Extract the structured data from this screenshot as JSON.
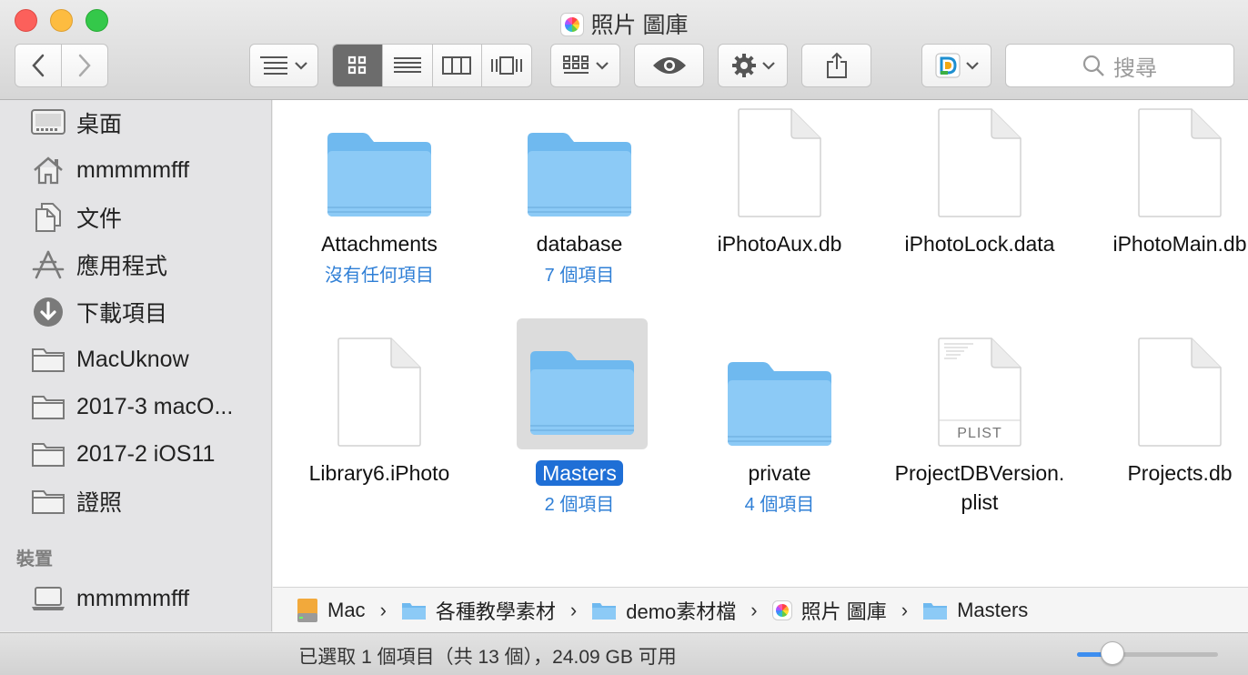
{
  "window": {
    "title": "照片 圖庫"
  },
  "toolbar": {
    "search_placeholder": "搜尋",
    "view_modes": [
      "icon-view",
      "list-view",
      "column-view",
      "coverflow-view"
    ],
    "active_view": "icon-view"
  },
  "sidebar": {
    "favorites": [
      {
        "label": "桌面",
        "icon": "desktop-icon"
      },
      {
        "label": "mmmmmfff",
        "icon": "home-icon"
      },
      {
        "label": "文件",
        "icon": "documents-icon"
      },
      {
        "label": "應用程式",
        "icon": "applications-icon"
      },
      {
        "label": "下載項目",
        "icon": "downloads-icon"
      },
      {
        "label": "MacUknow",
        "icon": "folder-icon"
      },
      {
        "label": "2017-3 macO...",
        "icon": "folder-icon"
      },
      {
        "label": "2017-2 iOS11",
        "icon": "folder-icon"
      },
      {
        "label": "證照",
        "icon": "folder-icon"
      }
    ],
    "devices_title": "裝置",
    "devices": [
      {
        "label": "mmmmmfff",
        "icon": "laptop-icon"
      }
    ]
  },
  "files": [
    {
      "name": "Attachments",
      "sub": "沒有任何項目",
      "kind": "folder"
    },
    {
      "name": "database",
      "sub": "7 個項目",
      "kind": "folder"
    },
    {
      "name": "iPhotoAux.db",
      "sub": "",
      "kind": "file"
    },
    {
      "name": "iPhotoLock.data",
      "sub": "",
      "kind": "file"
    },
    {
      "name": "iPhotoMain.db",
      "sub": "",
      "kind": "file"
    },
    {
      "name": "Library6.iPhoto",
      "sub": "",
      "kind": "file"
    },
    {
      "name": "Masters",
      "sub": "2 個項目",
      "kind": "folder",
      "selected": true
    },
    {
      "name": "private",
      "sub": "4 個項目",
      "kind": "folder"
    },
    {
      "name": "ProjectDBVersion.",
      "name2": "plist",
      "sub": "",
      "kind": "plist",
      "badge": "PLIST"
    },
    {
      "name": "Projects.db",
      "sub": "",
      "kind": "file"
    }
  ],
  "pathbar": [
    {
      "label": "Mac",
      "icon": "disk-icon"
    },
    {
      "label": "各種教學素材",
      "icon": "folder-icon"
    },
    {
      "label": "demo素材檔",
      "icon": "folder-icon"
    },
    {
      "label": "照片 圖庫",
      "icon": "photos-library-icon"
    },
    {
      "label": "Masters",
      "icon": "folder-icon"
    }
  ],
  "status": {
    "text": "已選取 1 個項目（共 13 個），24.09 GB 可用",
    "icon_size_fraction": 0.25
  },
  "colors": {
    "accent": "#1f6fd6",
    "folder": "#6fb9ef",
    "subtext": "#2f7fd6"
  }
}
